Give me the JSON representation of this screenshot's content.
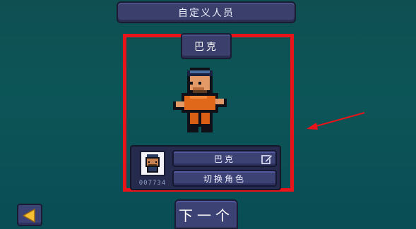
{
  "header": {
    "title": "自定义人员"
  },
  "character": {
    "name": "巴克",
    "id": "007734",
    "name_button_label": "巴克",
    "switch_button_label": "切换角色"
  },
  "footer": {
    "next_label": "下一个"
  },
  "icons": {
    "edit": "pencil-edit-icon",
    "back": "back-arrow-icon"
  },
  "colors": {
    "highlight_frame": "#e8141a",
    "back_arrow": "#f6c033",
    "button": "#3d4275"
  }
}
